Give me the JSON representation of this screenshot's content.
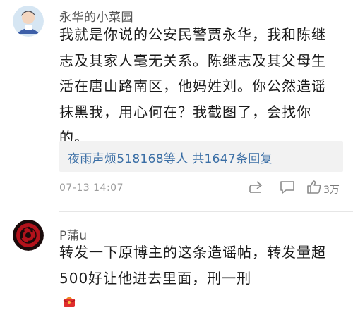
{
  "comments": [
    {
      "username": "永华的小菜园",
      "body_lines": [
        "我就是你说的公安民警贾永华，我和陈继",
        "志及其家人毫无关系。陈继志及其父母生",
        "活在唐山路南区，他妈姓刘。你公然造谣",
        "抹黑我，用心何在？我截图了，会找你",
        "的。"
      ],
      "reply_summary": "夜雨声烦518168等人 共1647条回复",
      "timestamp": "07-13 14:07",
      "like_count": "3万",
      "icons": [
        "share-icon",
        "comment-icon",
        "thumbs-up-icon"
      ]
    },
    {
      "username": "P蒲u",
      "body_lines": [
        "转发一下原博主的这条造谣帖，转发量超",
        "500好让他进去里面，刑一刑"
      ],
      "trailing_emoji": "red-envelope-icon"
    }
  ],
  "colors": {
    "link_blue": "#3a6ea5",
    "meta_gray": "#9b9b9b",
    "reply_bg": "#f2f2f2"
  }
}
